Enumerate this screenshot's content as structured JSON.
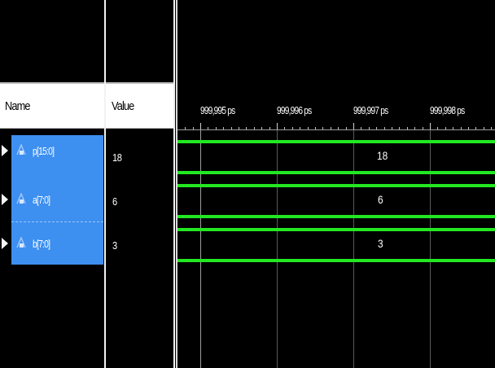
{
  "header": {
    "name_label": "Name",
    "value_label": "Value"
  },
  "timeline": {
    "labels": [
      "999,995 ps",
      "999,996 ps",
      "999,997 ps",
      "999,998 ps"
    ]
  },
  "signals": [
    {
      "name": "p[15:0]",
      "value": "18",
      "waveform_value": "18",
      "icon": "bus-signal-icon"
    },
    {
      "name": "a[7:0]",
      "value": "6",
      "waveform_value": "6",
      "icon": "bus-signal-icon"
    },
    {
      "name": "b[7:0]",
      "value": "3",
      "waveform_value": "3",
      "icon": "bus-signal-icon"
    }
  ],
  "colors": {
    "waveform": "#22e822",
    "selection": "#3d8ff0",
    "background": "#000000"
  }
}
